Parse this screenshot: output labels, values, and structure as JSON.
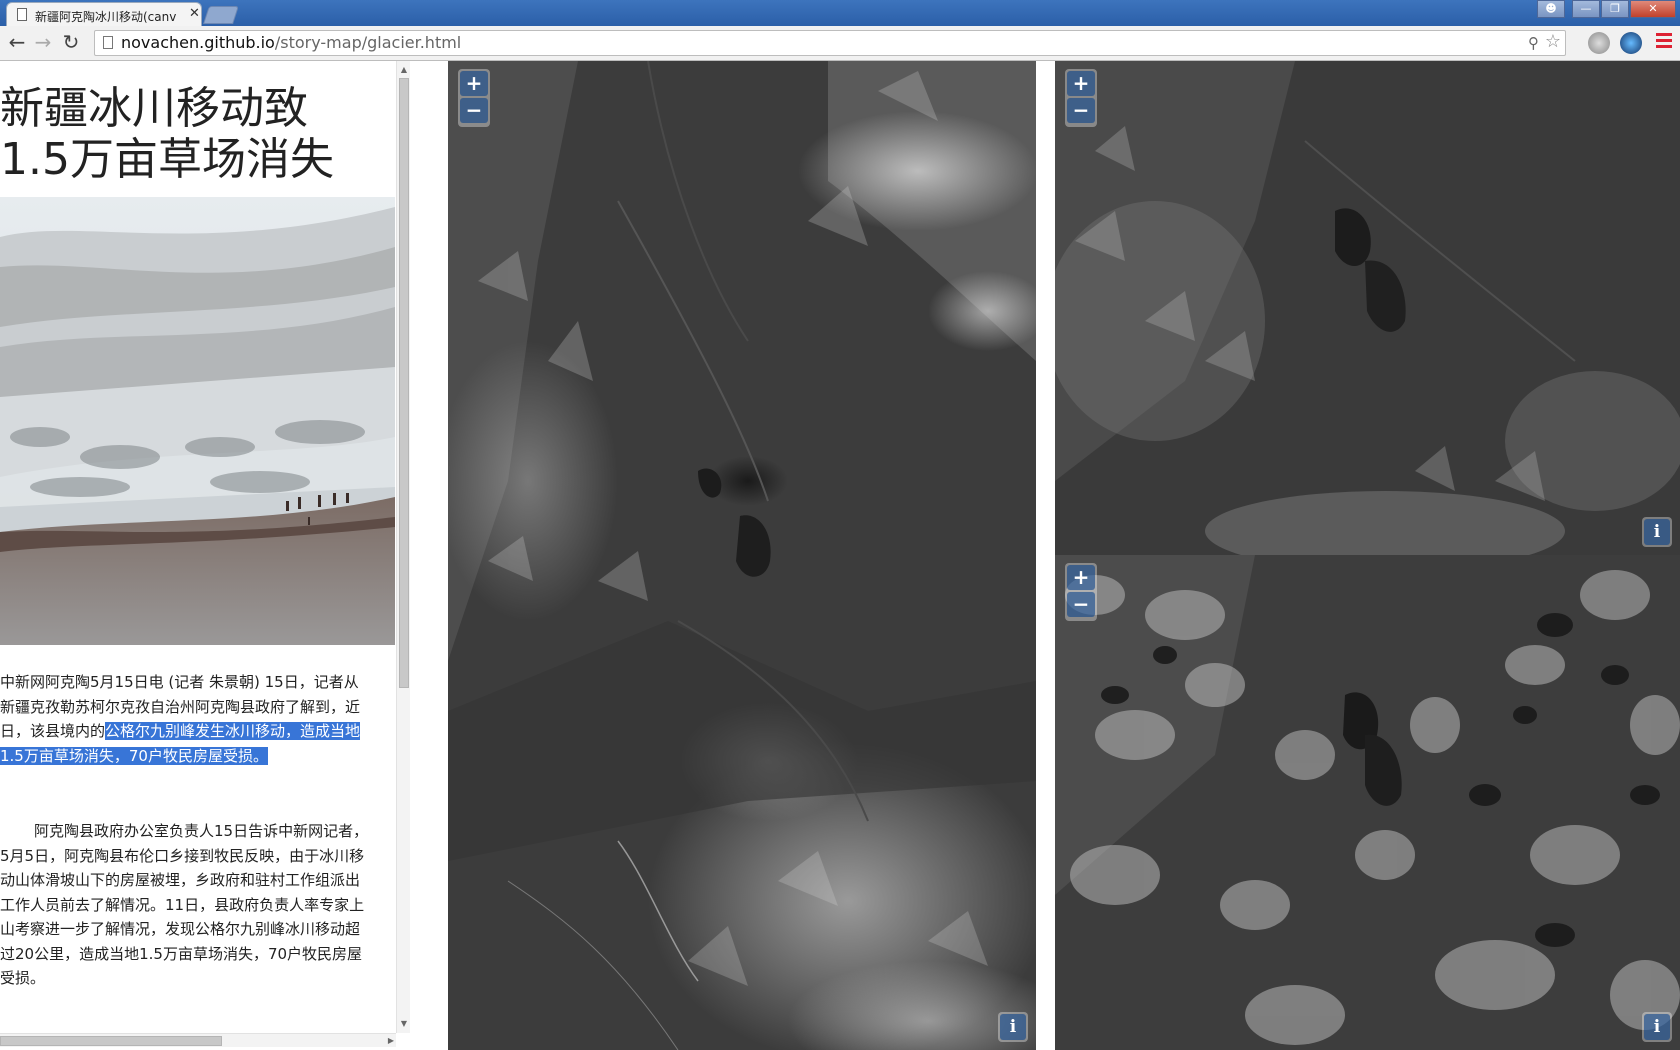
{
  "browser": {
    "tab_title": "新疆阿克陶冰川移动(canv",
    "tab_close": "✕",
    "url_host": "novachen.github.io",
    "url_path": "/story-map/glacier.html",
    "window_buttons": [
      "user-icon",
      "minimize-icon",
      "restore-icon",
      "close-icon"
    ]
  },
  "story": {
    "title_line1": "新疆冰川移动致",
    "title_line2": "1.5万亩草场消失",
    "paragraph1_before": "中新网阿克陶5月15日电 (记者 朱景朝) 15日，记者从新疆克孜勒苏柯尔克孜自治州阿克陶县政府了解到，近日，该县境内的",
    "paragraph1_highlight": "公格尔九别峰发生冰川移动，造成当地1.5万亩草场消失，70户牧民房屋受损。",
    "paragraph2": "阿克陶县政府办公室负责人15日告诉中新网记者，5月5日，阿克陶县布伦口乡接到牧民反映，由于冰川移动山体滑坡山下的房屋被埋，乡政府和驻村工作组派出工作人员前去了解情况。11日，县政府负责人率专家上山考察进一步了解情况，发现公格尔九别峰冰川移动超过20公里，造成当地1.5万亩草场消失，70户牧民房屋受损。"
  },
  "maps": {
    "zoom_in": "+",
    "zoom_out": "−",
    "info": "i"
  }
}
